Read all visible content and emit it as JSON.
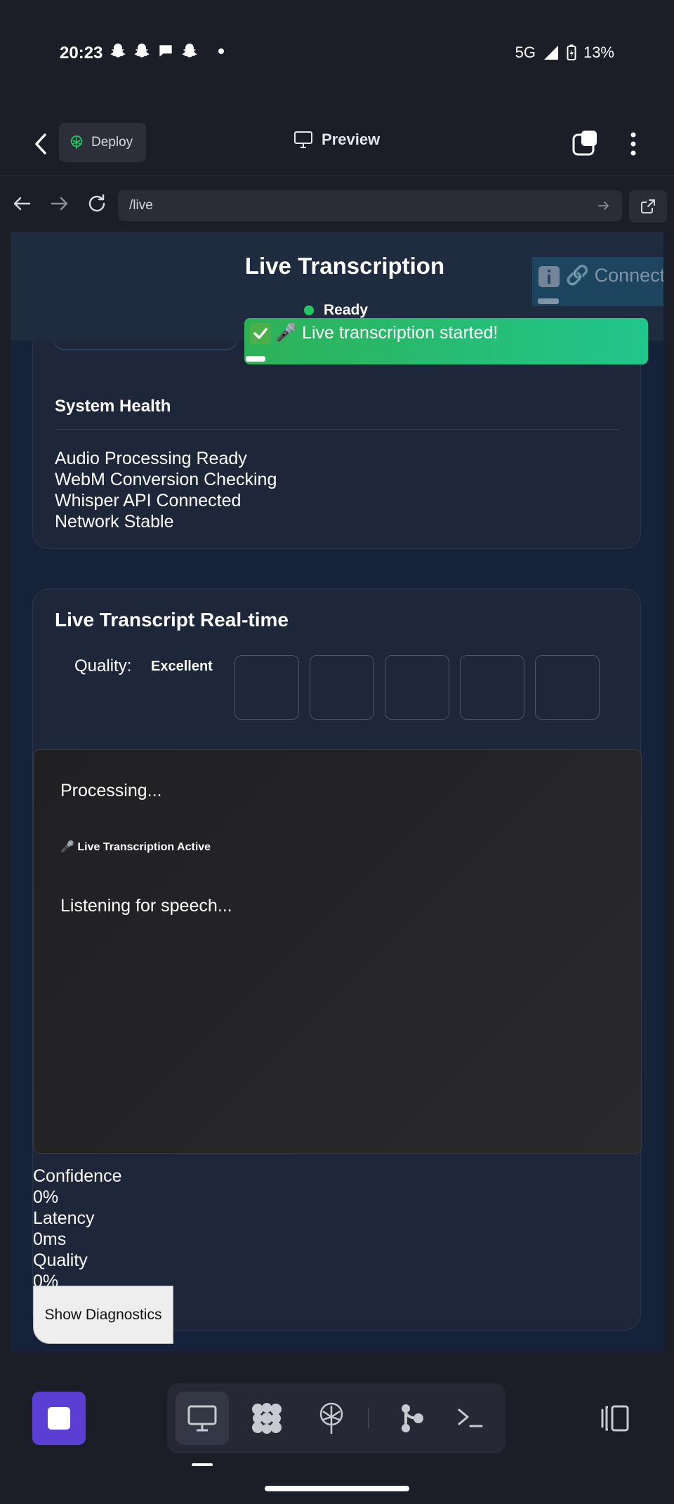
{
  "status_bar": {
    "time": "20:23",
    "network": "5G",
    "battery": "13%"
  },
  "app_header": {
    "deploy_label": "Deploy",
    "preview_label": "Preview"
  },
  "browser": {
    "url": "/live"
  },
  "page": {
    "title": "Live Transcription",
    "status": "Ready",
    "connecting_toast": "🔗 Connecting",
    "success_toast": "🎤 Live transcription started!",
    "system_health": {
      "title": "System Health",
      "items": [
        "Audio Processing Ready",
        "WebM Conversion Checking",
        "Whisper API Connected",
        "Network Stable"
      ]
    },
    "transcript": {
      "title": "Live Transcript Real-time",
      "quality_label": "Quality:",
      "quality_value": "Excellent",
      "processing": "Processing...",
      "active_label": "🎤 Live Transcription Active",
      "listening": "Listening for speech..."
    },
    "metrics": {
      "confidence_label": "Confidence",
      "confidence_value": "0%",
      "latency_label": "Latency",
      "latency_value": "0ms",
      "quality_label": "Quality",
      "quality_value": "0%"
    },
    "diagnostics_button": "Show Diagnostics"
  },
  "colors": {
    "accent": "#5b3fd4",
    "ready": "#22c55e",
    "toast_start": "#2db157",
    "toast_end": "#21c68c"
  }
}
